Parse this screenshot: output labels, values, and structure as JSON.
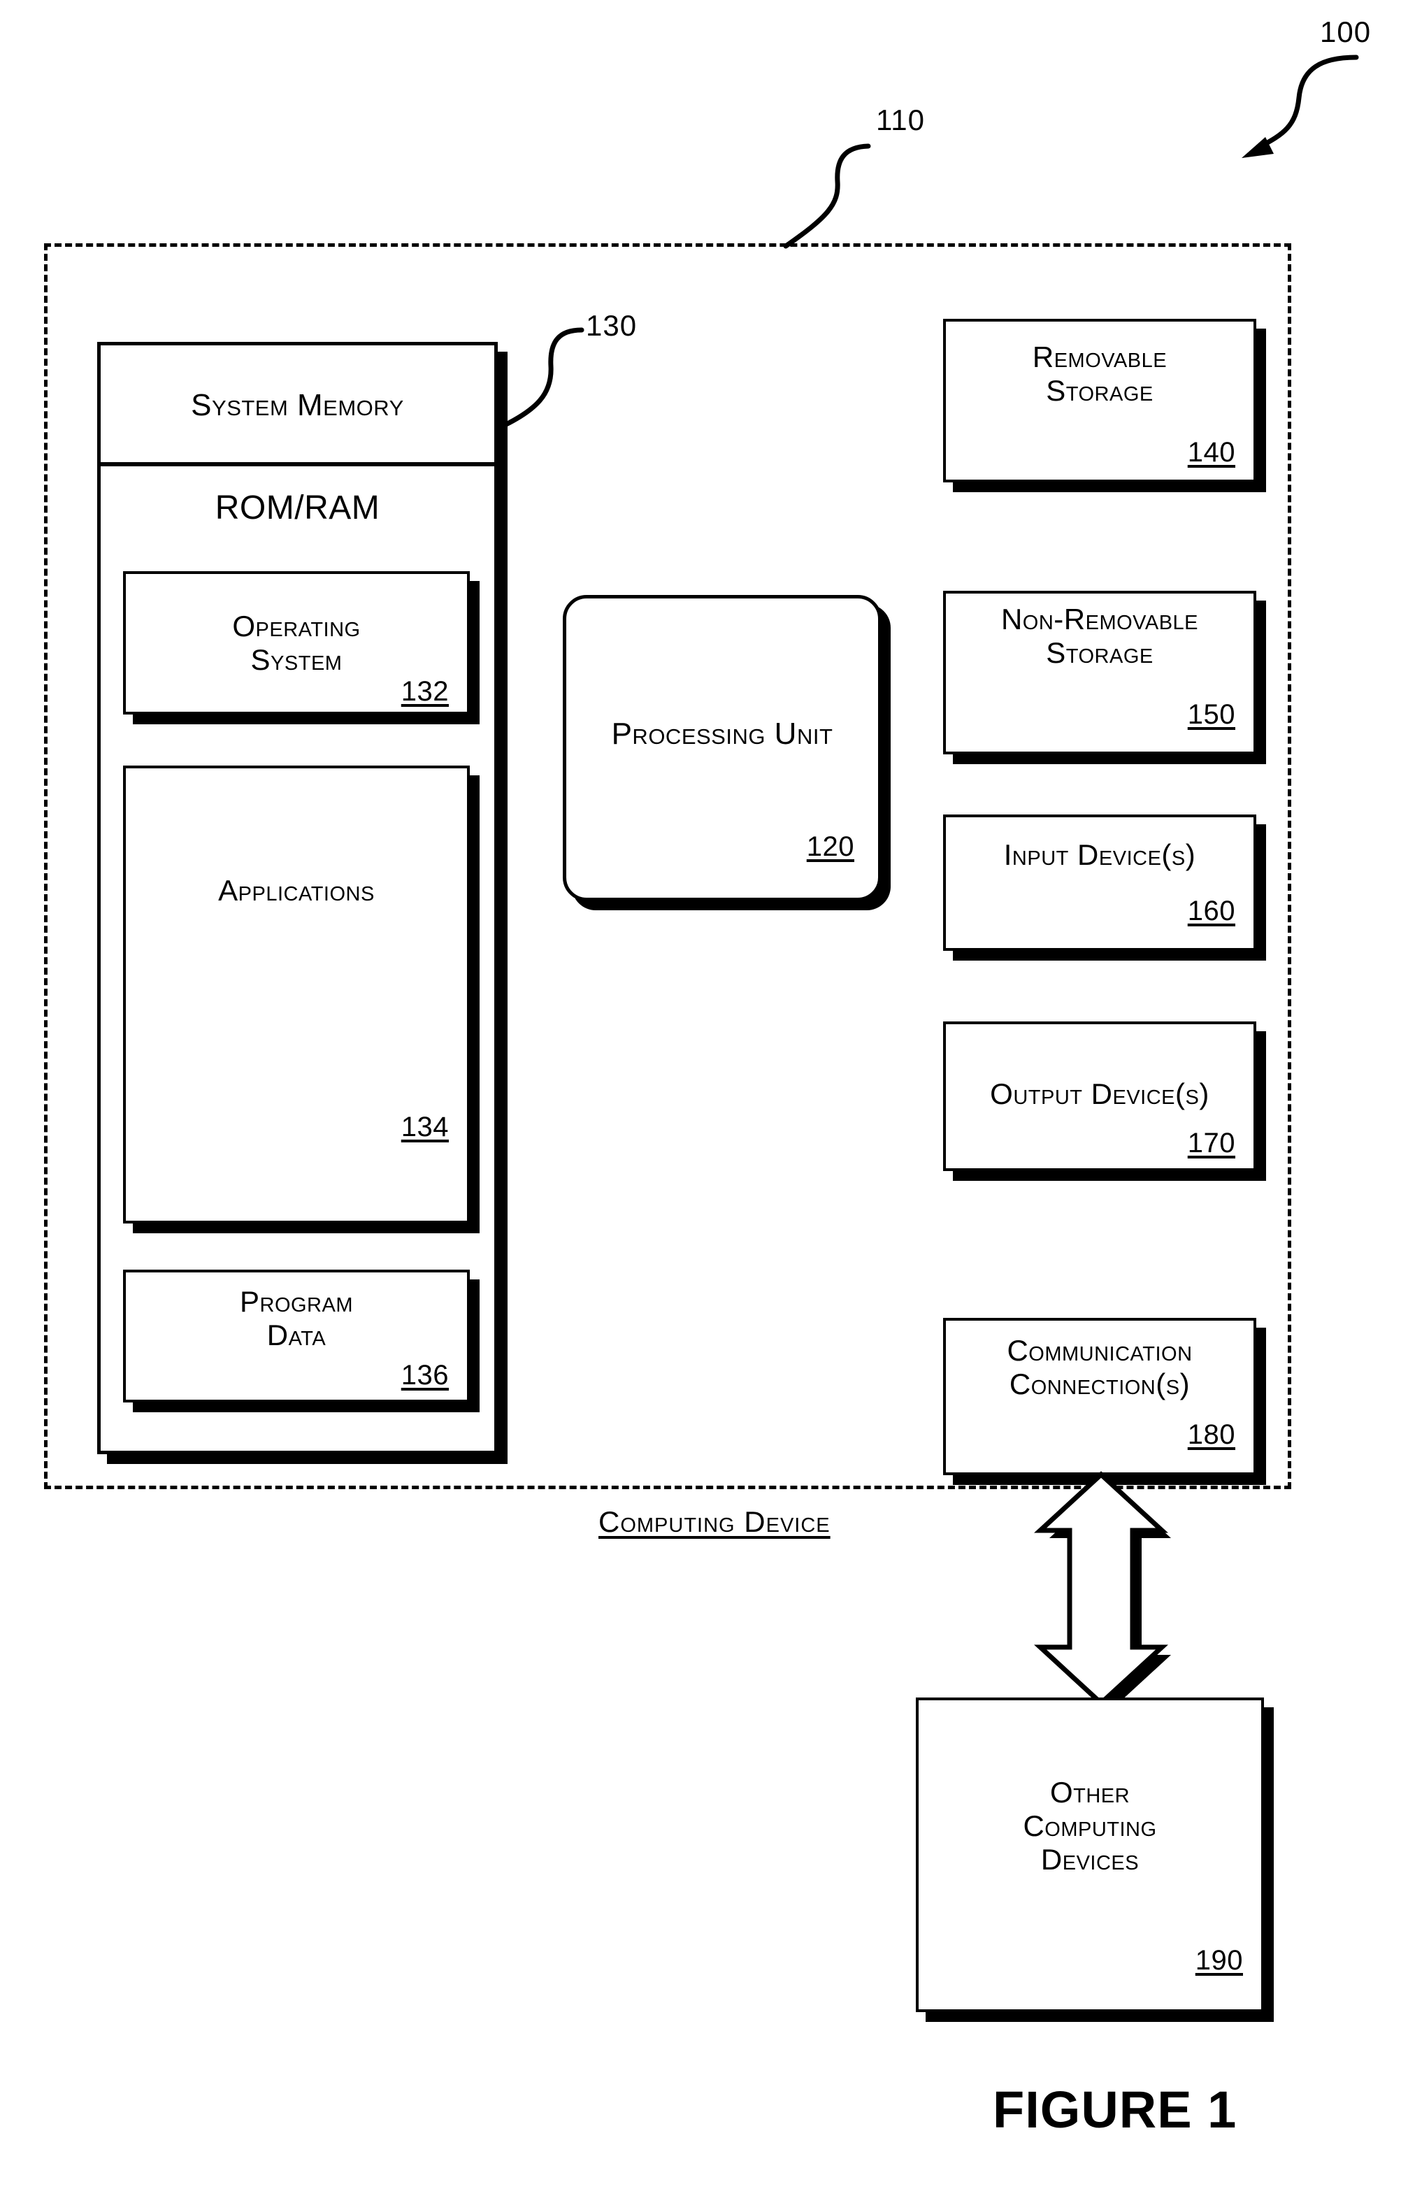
{
  "figure": {
    "caption": "FIGURE 1",
    "overall_ref": "100",
    "device_region_ref": "110",
    "device_caption": "Computing Device"
  },
  "system_memory": {
    "title": "System Memory",
    "ref": "130",
    "memory_type": "ROM/RAM",
    "components": [
      {
        "name": "operating-system",
        "label": "Operating\nSystem",
        "ref": "132"
      },
      {
        "name": "applications",
        "label": "Applications",
        "ref": "134"
      },
      {
        "name": "program-data",
        "label": "Program\nData",
        "ref": "136"
      }
    ]
  },
  "processing_unit": {
    "label": "Processing Unit",
    "ref": "120"
  },
  "peripherals": [
    {
      "name": "removable-storage",
      "label": "Removable\nStorage",
      "ref": "140"
    },
    {
      "name": "non-removable-storage",
      "label": "Non-Removable\nStorage",
      "ref": "150"
    },
    {
      "name": "input-devices",
      "label": "Input Device(s)",
      "ref": "160"
    },
    {
      "name": "output-devices",
      "label": "Output Device(s)",
      "ref": "170"
    },
    {
      "name": "communication-connections",
      "label": "Communication\nConnection(s)",
      "ref": "180"
    }
  ],
  "external": {
    "label": "Other\nComputing\nDevices",
    "ref": "190"
  },
  "colors": {
    "ink": "#000000",
    "paper": "#ffffff"
  }
}
